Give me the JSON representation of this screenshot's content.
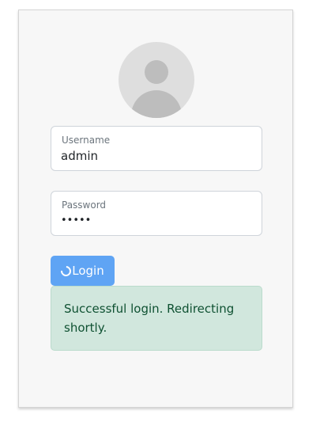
{
  "login_form": {
    "username": {
      "label": "Username",
      "value": "admin"
    },
    "password": {
      "label": "Password",
      "value": "•••••"
    },
    "login_button_label": "Login",
    "status_message": "Successful login. Redirecting shortly."
  },
  "icons": {
    "avatar": "user-avatar-icon",
    "spinner": "loading-spinner-icon"
  },
  "colors": {
    "button": "#5fa4f4",
    "alert_background": "#d1e7dd",
    "alert_text": "#0f5132"
  }
}
